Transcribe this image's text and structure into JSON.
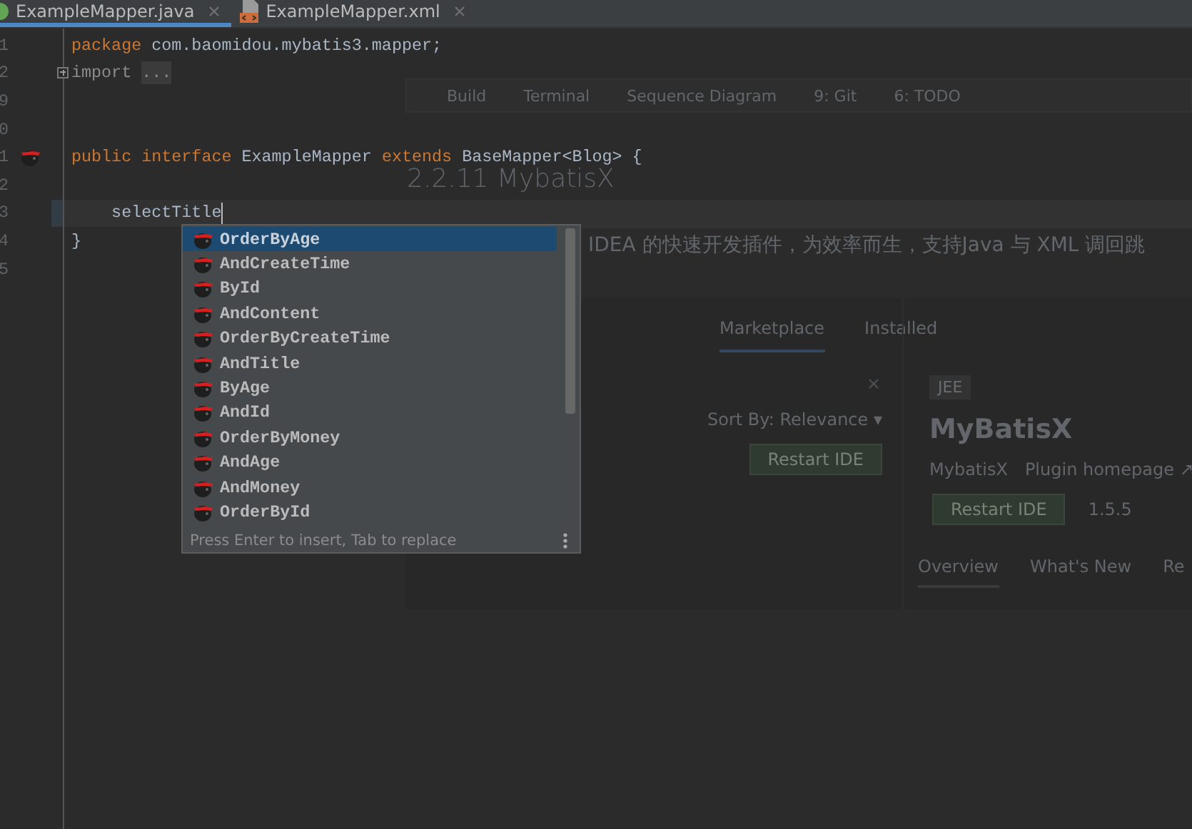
{
  "tabs": [
    {
      "label": "ExampleMapper.java",
      "kind": "java",
      "selected": true
    },
    {
      "label": "ExampleMapper.xml",
      "kind": "xml",
      "selected": false
    }
  ],
  "editor": {
    "lines": [
      {
        "number": "1",
        "tokens": [
          {
            "text": "package",
            "kind": "keyword"
          },
          {
            "text": " com.baomidou.mybatis3.mapper;",
            "kind": "plain"
          }
        ]
      },
      {
        "number": "2",
        "folded": true,
        "tokens": [
          {
            "text": "import",
            "kind": "folded"
          },
          {
            "text": "...",
            "kind": "ellipsis"
          }
        ]
      },
      {
        "number": "9"
      },
      {
        "number": "0"
      },
      {
        "number": "1",
        "gutter_icon": true,
        "tokens": [
          {
            "text": "public",
            "kind": "keyword"
          },
          {
            "text": " interface",
            "kind": "keyword"
          },
          {
            "text": " ExampleMapper ",
            "kind": "plain"
          },
          {
            "text": "extends",
            "kind": "keyword"
          },
          {
            "text": " BaseMapper<Blog> {",
            "kind": "plain"
          }
        ]
      },
      {
        "number": "2"
      },
      {
        "number": "3",
        "current": true,
        "tokens": [
          {
            "text": "    selectTitle",
            "kind": "plain"
          }
        ]
      },
      {
        "number": "4",
        "tokens": [
          {
            "text": "}",
            "kind": "plain"
          }
        ]
      },
      {
        "number": "5"
      }
    ]
  },
  "completion": {
    "items": [
      {
        "label": "OrderByAge",
        "selected": true
      },
      {
        "label": "AndCreateTime",
        "selected": false
      },
      {
        "label": "ById",
        "selected": false
      },
      {
        "label": "AndContent",
        "selected": false
      },
      {
        "label": "OrderByCreateTime",
        "selected": false
      },
      {
        "label": "AndTitle",
        "selected": false
      },
      {
        "label": "ByAge",
        "selected": false
      },
      {
        "label": "AndId",
        "selected": false
      },
      {
        "label": "OrderByMoney",
        "selected": false
      },
      {
        "label": "AndAge",
        "selected": false
      },
      {
        "label": "AndMoney",
        "selected": false
      },
      {
        "label": "OrderById",
        "selected": false
      }
    ],
    "hint": "Press Enter to insert, Tab to replace"
  },
  "background_image": {
    "toolbar": [
      "Build",
      "Terminal",
      "Sequence Diagram",
      "9: Git",
      "6: TODO"
    ],
    "heading": "2.2.11 MybatisX",
    "paragraph": "IDEA 的快速开发插件，为效率而生，支持Java 与 XML 调回跳",
    "plugins_dialog": {
      "tabs": [
        {
          "label": "Marketplace",
          "selected": true
        },
        {
          "label": "Installed",
          "selected": false
        }
      ],
      "sort": "Sort By: Relevance ▾",
      "result": {
        "button": "Restart IDE"
      },
      "detail": {
        "tag": "JEE",
        "name": "MyBatisX",
        "vendor": "MybatisX",
        "homepage": "Plugin homepage ↗",
        "button": "Restart IDE",
        "version": "1.5.5",
        "tabs": [
          {
            "label": "Overview",
            "selected": true
          },
          {
            "label": "What's New",
            "selected": false
          },
          {
            "label": "Re",
            "selected": false
          }
        ]
      }
    }
  }
}
